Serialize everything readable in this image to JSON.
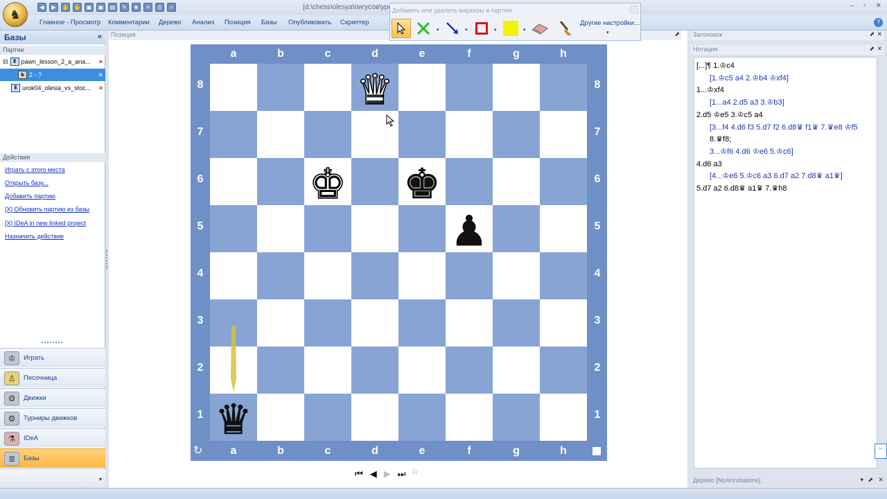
{
  "window": {
    "title": "[d:\\chess\\olesya\\пигусов\\урок",
    "qat_icons": [
      "back-icon",
      "forward-icon",
      "hand-icon",
      "hand2-icon",
      "save-icon",
      "save-as-icon",
      "clipboard-icon",
      "pen-icon",
      "stop-icon",
      "list-icon",
      "print-icon",
      "search-icon"
    ],
    "controls": {
      "minimize": "–",
      "restore": "▫",
      "close": "✕"
    }
  },
  "menu": [
    "Главное - Просмотр",
    "Комментарии",
    "Дерево",
    "Анализ",
    "Позиция",
    "Базы",
    "Опубликовать",
    "Скриптер"
  ],
  "markers_popup": {
    "title": "Добавить или удалить маркеры в партию",
    "other_settings": "Другие настройки...",
    "tools": [
      "pointer-tool",
      "green-x-tool",
      "arrow-tool",
      "red-square-tool",
      "yellow-fill-tool",
      "eraser-tool",
      "broom-tool"
    ]
  },
  "left": {
    "header": "Базы",
    "games_section": "Партии",
    "games": [
      {
        "label": "pawn_lesson_2_a_ana...",
        "child": "2 - ?"
      },
      {
        "label": "urok04_olesia_vs_stoc..."
      }
    ],
    "actions_section": "Действия",
    "actions": [
      "Играть с этого места",
      "Открыть базу...",
      "Добавить партию",
      "[X] Обновить партию из базы",
      "[X] IDeA in new linked project",
      "Назначить действие"
    ],
    "nav": [
      "Играть",
      "Песочница",
      "Движки",
      "Турниры движков",
      "IDeA",
      "Базы"
    ]
  },
  "center": {
    "position_header": "Позиция",
    "files": [
      "a",
      "b",
      "c",
      "d",
      "e",
      "f",
      "g",
      "h"
    ],
    "ranks": [
      "8",
      "7",
      "6",
      "5",
      "4",
      "3",
      "2",
      "1"
    ],
    "pieces": [
      {
        "glyph": "♛",
        "color": "white",
        "square": "d8",
        "name": "white-queen"
      },
      {
        "glyph": "♚",
        "color": "white",
        "square": "c6",
        "name": "white-king"
      },
      {
        "glyph": "♚",
        "color": "black",
        "square": "e6",
        "name": "black-king"
      },
      {
        "glyph": "♟",
        "color": "black",
        "square": "f5",
        "name": "black-pawn"
      },
      {
        "glyph": "♛",
        "color": "black",
        "square": "a1",
        "name": "black-queen"
      }
    ],
    "flip_icon": "↻",
    "nav_controls": [
      "⏮",
      "◀",
      "▶",
      "⏭",
      "R"
    ]
  },
  "right": {
    "header_top": "Заголовок",
    "notation_header": "Нотация",
    "tree_header": "Дерево [NoAnnotations]",
    "notation": [
      {
        "text": "[...]¶ 1.♔c4",
        "indent": false,
        "variation": false
      },
      {
        "text": "[1.♔c5 a4 2.♔b4 ♔xf4]",
        "indent": true,
        "variation": true
      },
      {
        "text": "1...♔xf4",
        "indent": false,
        "variation": false
      },
      {
        "text": "[1...a4 2.d5 a3 3.♔b3]",
        "indent": true,
        "variation": true
      },
      {
        "text": "2.d5 ♔e5 3.♔c5 a4",
        "indent": false,
        "variation": false
      },
      {
        "text": "[3...f4 4.d6 f3 5.d7 f2 6.d8♛ f1♛ 7.♛e8 ♔f5",
        "indent": true,
        "variation": true
      },
      {
        "text": "8.♛f8;",
        "indent": true,
        "variation": false
      },
      {
        "text": "3...♔f6 4.d6 ♔e6 5.♔c6]",
        "indent": true,
        "variation": true
      },
      {
        "text": "4.d6 a3",
        "indent": false,
        "variation": false
      },
      {
        "text": "[4...♔e6 5.♔c6 a3 6.d7 a2 7.d8♛ a1♛]",
        "indent": true,
        "variation": true
      },
      {
        "text": "5.d7 a2 6.d8♛ a1♛ 7.♛h8",
        "indent": false,
        "variation": false
      }
    ]
  },
  "colors": {
    "dark_square": "#87a4d5",
    "light_square": "#ffffff",
    "frame": "#6f8fc7",
    "accent": "#ffb640"
  }
}
